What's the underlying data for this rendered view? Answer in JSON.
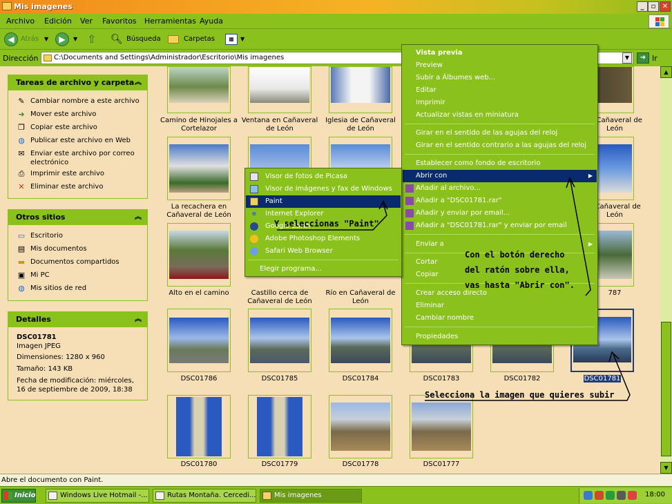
{
  "window": {
    "title": "Mis imagenes"
  },
  "menubar": [
    "Archivo",
    "Edición",
    "Ver",
    "Favoritos",
    "Herramientas",
    "Ayuda"
  ],
  "toolbar": {
    "back": "Atrás",
    "search": "Búsqueda",
    "folders": "Carpetas"
  },
  "address": {
    "label": "Dirección",
    "path": "C:\\Documents and Settings\\Administrador\\Escritorio\\Mis imagenes",
    "go": "Ir"
  },
  "tasks_panel": {
    "title": "Tareas de archivo y carpeta",
    "items": [
      "Cambiar nombre a este archivo",
      "Mover este archivo",
      "Copiar este archivo",
      "Publicar este archivo en Web",
      "Enviar este archivo por correo electrónico",
      "Imprimir este archivo",
      "Eliminar este archivo"
    ]
  },
  "places_panel": {
    "title": "Otros sitios",
    "items": [
      "Escritorio",
      "Mis documentos",
      "Documentos compartidos",
      "Mi PC",
      "Mis sitios de red"
    ]
  },
  "details_panel": {
    "title": "Detalles",
    "name": "DSC01781",
    "type": "Imagen JPEG",
    "dimensions": "Dimensiones: 1280 x 960",
    "size": "Tamaño: 143 KB",
    "modified": "Fecha de modificación: miércoles, 16 de septiembre de 2009, 18:38"
  },
  "thumbnails": [
    {
      "caption": "Camino de Hinojales a Cortelazor"
    },
    {
      "caption": "Ventana en Cañaveral de León"
    },
    {
      "caption": "Iglesia de Cañaveral de León"
    },
    {
      "caption": "or Cañaveral de León"
    },
    {
      "caption": "La recachera en Cañaveral de León"
    },
    {
      "caption": "e Cañaveral de León"
    },
    {
      "caption": "Alto en el camino"
    },
    {
      "caption": "Castillo cerca de Cañaveral de León"
    },
    {
      "caption": "Río en Cañaveral de León"
    },
    {
      "caption": "787"
    },
    {
      "caption": "DSC01786"
    },
    {
      "caption": "DSC01785"
    },
    {
      "caption": "DSC01784"
    },
    {
      "caption": "DSC01783"
    },
    {
      "caption": "DSC01782"
    },
    {
      "caption": "DSC01781"
    },
    {
      "caption": "DSC01780"
    },
    {
      "caption": "DSC01779"
    },
    {
      "caption": "DSC01778"
    },
    {
      "caption": "DSC01777"
    }
  ],
  "context_menu": {
    "items": [
      "Vista previa",
      "Preview",
      "Subir a Álbumes web...",
      "Editar",
      "Imprimir",
      "Actualizar vistas en miniatura",
      "Girar en el sentido de las agujas del reloj",
      "Girar en el sentido contrario a las agujas del reloj",
      "Establecer como fondo de escritorio",
      "Abrir con",
      "Añadir al archivo...",
      "Añadir a \"DSC01781.rar\"",
      "Añadir y enviar por email...",
      "Añadir a \"DSC01781.rar\" y enviar por email",
      "Enviar a",
      "Cortar",
      "Copiar",
      "Crear acceso directo",
      "Eliminar",
      "Cambiar nombre",
      "Propiedades"
    ]
  },
  "open_with_menu": {
    "items": [
      "Visor de fotos de Picasa",
      "Visor de imágenes y fax de Windows",
      "Paint",
      "Internet Explorer",
      "Google Earth",
      "Adobe Photoshop Elements",
      "Safari Web Browser",
      "Elegir programa..."
    ]
  },
  "annotations": {
    "paint": "Y seleccionas \"Paint\"",
    "right_click": [
      "Con el botón derecho",
      "del ratón sobre ella,",
      "vas hasta \"Abrir con\"."
    ],
    "select": "Selecciona la imagen que quieres subir"
  },
  "statusbar": "Abre el documento con Paint.",
  "taskbar": {
    "start": "Inicio",
    "tasks": [
      "Windows Live Hotmail -...",
      "Rutas Montaña. Cercedi...",
      "Mis imagenes"
    ],
    "clock": "18:00"
  },
  "colors": {
    "theme_green": "#8bc11c",
    "background": "#f6dfb6",
    "highlight": "#0a2a6e"
  }
}
